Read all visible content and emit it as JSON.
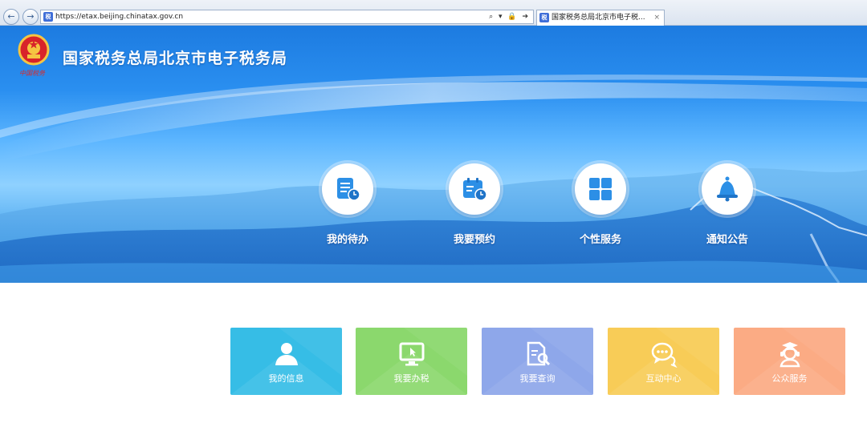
{
  "browser": {
    "url": "https://etax.beijing.chinatax.gov.cn",
    "tab_title": "国家税务总局北京市电子税...",
    "favicon_text": "税",
    "addr_controls": "⌕ ▾ 🔒 ➔",
    "tab_close": "×",
    "back_symbol": "←",
    "forward_symbol": "→"
  },
  "header": {
    "site_title": "国家税务总局北京市电子税务局",
    "emblem_script": "中国税务"
  },
  "features": [
    {
      "label": "我的待办",
      "icon": "todo-list-icon"
    },
    {
      "label": "我要预约",
      "icon": "calendar-clock-icon"
    },
    {
      "label": "个性服务",
      "icon": "grid-apps-icon"
    },
    {
      "label": "通知公告",
      "icon": "bell-icon"
    }
  ],
  "tiles": [
    {
      "label": "我的信息",
      "icon": "user-icon",
      "color": "#36bde6"
    },
    {
      "label": "我要办税",
      "icon": "monitor-cursor-icon",
      "color": "#8bd86d"
    },
    {
      "label": "我要查询",
      "icon": "document-search-icon",
      "color": "#8ea7ea"
    },
    {
      "label": "互动中心",
      "icon": "chat-bubbles-icon",
      "color": "#f8cc57"
    },
    {
      "label": "公众服务",
      "icon": "service-agent-icon",
      "color": "#fbab84"
    }
  ],
  "colors": {
    "banner_top": "#1d7be0",
    "icon_blue": "#2c8fe6",
    "title_text": "#ffffff"
  }
}
